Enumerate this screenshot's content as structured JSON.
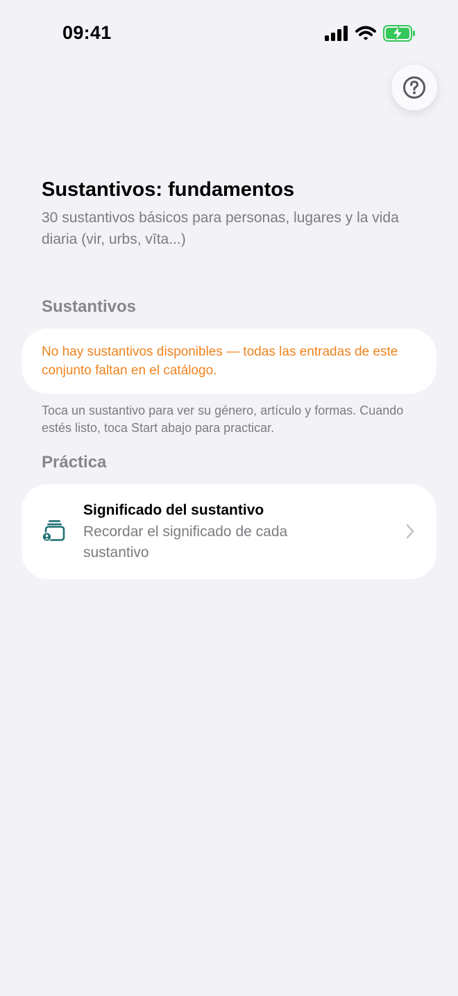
{
  "status_bar": {
    "time": "09:41"
  },
  "help_button": {
    "icon": "question-circle-icon"
  },
  "header": {
    "title": "Sustantivos: fundamentos",
    "subtitle": "30 sustantivos básicos para personas, lugares y la vida diaria (vir, urbs, vīta...)"
  },
  "nouns_section": {
    "heading": "Sustantivos",
    "empty_message": "No hay sustantivos disponibles — todas las entradas de este conjunto faltan en el catálogo.",
    "hint": "Toca un sustantivo para ver su género, artículo y formas. Cuando estés listo, toca Start abajo para practicar."
  },
  "practice_section": {
    "heading": "Práctica",
    "items": [
      {
        "title": "Significado del sustantivo",
        "description": "Recordar el significado de cada sustantivo",
        "icon": "flashcards-person-icon"
      }
    ]
  },
  "colors": {
    "background": "#f2f2f7",
    "warning": "#f0831d",
    "accent_icon": "#1f6f73",
    "secondary_text": "#7b7b80",
    "battery_green": "#34c759"
  }
}
